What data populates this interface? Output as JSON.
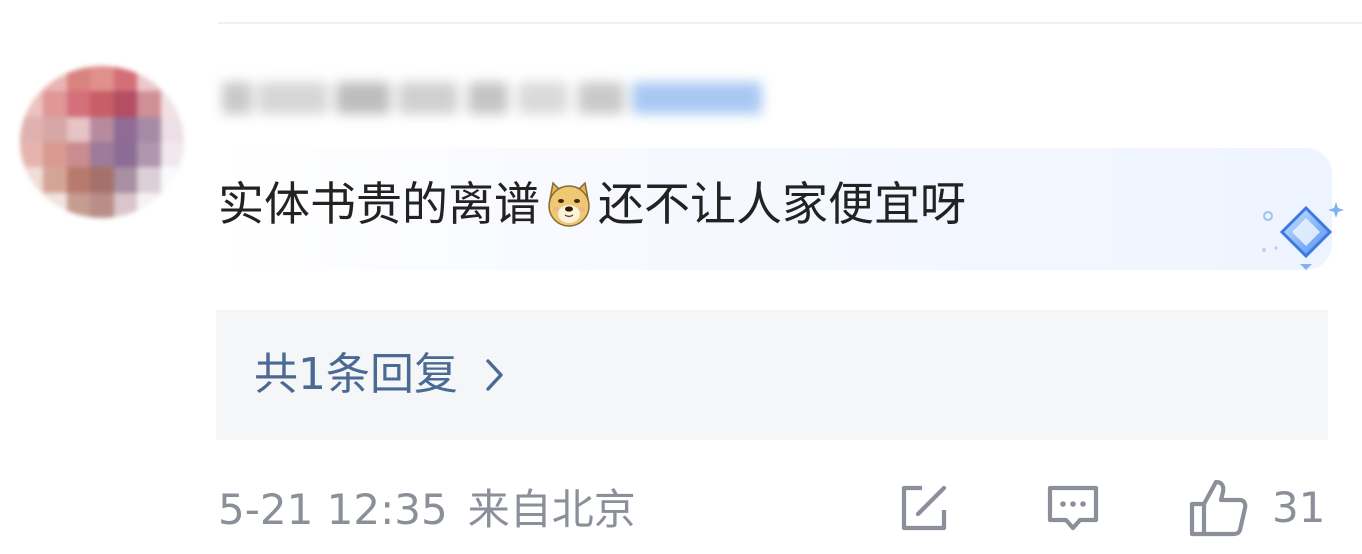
{
  "comment": {
    "text_before_emoji": "实体书贵的离谱",
    "emoji": "doge-emoji",
    "text_after_emoji": "还不让人家便宜呀",
    "badge": "diamond-badge-icon"
  },
  "replies": {
    "label": "共1条回复"
  },
  "meta": {
    "time": "5-21 12:35",
    "location": "来自北京"
  },
  "actions": {
    "share_icon": "share-icon",
    "comment_icon": "comment-icon",
    "like_icon": "thumbs-up-icon",
    "like_count": "31"
  },
  "colors": {
    "text": "#222222",
    "link": "#4a6a94",
    "meta": "#8a8f99",
    "reply_bg": "#f5f6f8",
    "bubble_accent": "#eef4ff"
  }
}
